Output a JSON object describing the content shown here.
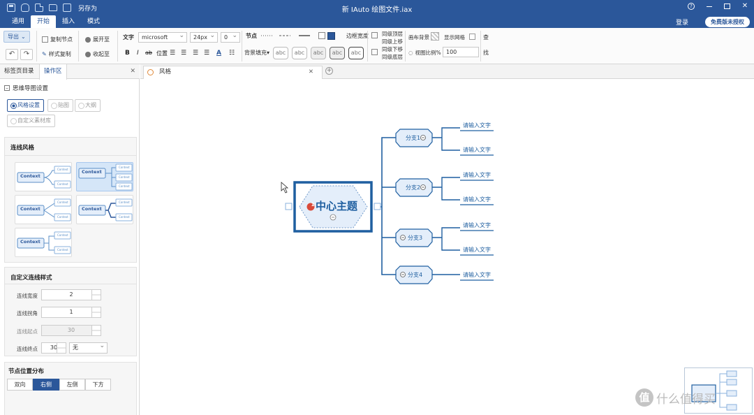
{
  "window": {
    "title": "新 IAuto 绘图文件.iax",
    "save_as": "另存为"
  },
  "menu": {
    "tabs": [
      "通用",
      "开始",
      "插入",
      "模式"
    ],
    "login": "登录",
    "license": "免费版未授权"
  },
  "ribbon": {
    "export": "导出",
    "copy_node": "复制节点",
    "copy_style": "样式复制",
    "expand": "展开至",
    "collapse": "收起至",
    "text_label": "文字",
    "font": "microsoft",
    "font_size": "24px",
    "spacing": "0",
    "bold": "B",
    "italic": "I",
    "strike": "ab",
    "position": "位置",
    "underline_a": "A",
    "node_label": "节点",
    "bg_fill": "背景填充▾",
    "abc": "abc",
    "border_width": "边框宽度",
    "level_top": "同级顶层",
    "level_up": "同级上移",
    "level_down": "同级下移",
    "level_bottom": "同级底层",
    "canvas_bg": "画布背景",
    "show_grid": "显示网格",
    "view_ratio": "视图比例%",
    "view_ratio_value": "100",
    "find": "查",
    "find2": "找"
  },
  "left_panel": {
    "tabs": [
      "标签页目录",
      "操作区"
    ],
    "mindmap_settings": "思维导图设置",
    "mode_radios": [
      "风格设置",
      "贴图",
      "大纲"
    ],
    "custom_library": "自定义素材库",
    "line_style_title": "连线风格",
    "thumb_main": "Context",
    "thumb_child": "Context",
    "custom_line_title": "自定义连线样式",
    "fields": [
      {
        "label": "连线宽度",
        "value": "2"
      },
      {
        "label": "连线拐角",
        "value": "1"
      },
      {
        "label": "连线起点",
        "value": "30"
      },
      {
        "label": "连线终点",
        "value": "30",
        "option": "无"
      }
    ],
    "node_dist_title": "节点位置分布",
    "dist_options": [
      "双向",
      "右侧",
      "左侧",
      "下方"
    ]
  },
  "canvas": {
    "doc_tab": "风格",
    "center": {
      "badge": "1",
      "label": "中心主题"
    },
    "branches": [
      "分支1",
      "分支2",
      "分支3",
      "分支4"
    ],
    "leaf_text": "请输入文字"
  },
  "watermark": {
    "logo": "值",
    "text": "什么值得买"
  },
  "colors": {
    "accent": "#2b579a",
    "node_border": "#1f5fa0",
    "node_fill": "#e4eefa"
  }
}
